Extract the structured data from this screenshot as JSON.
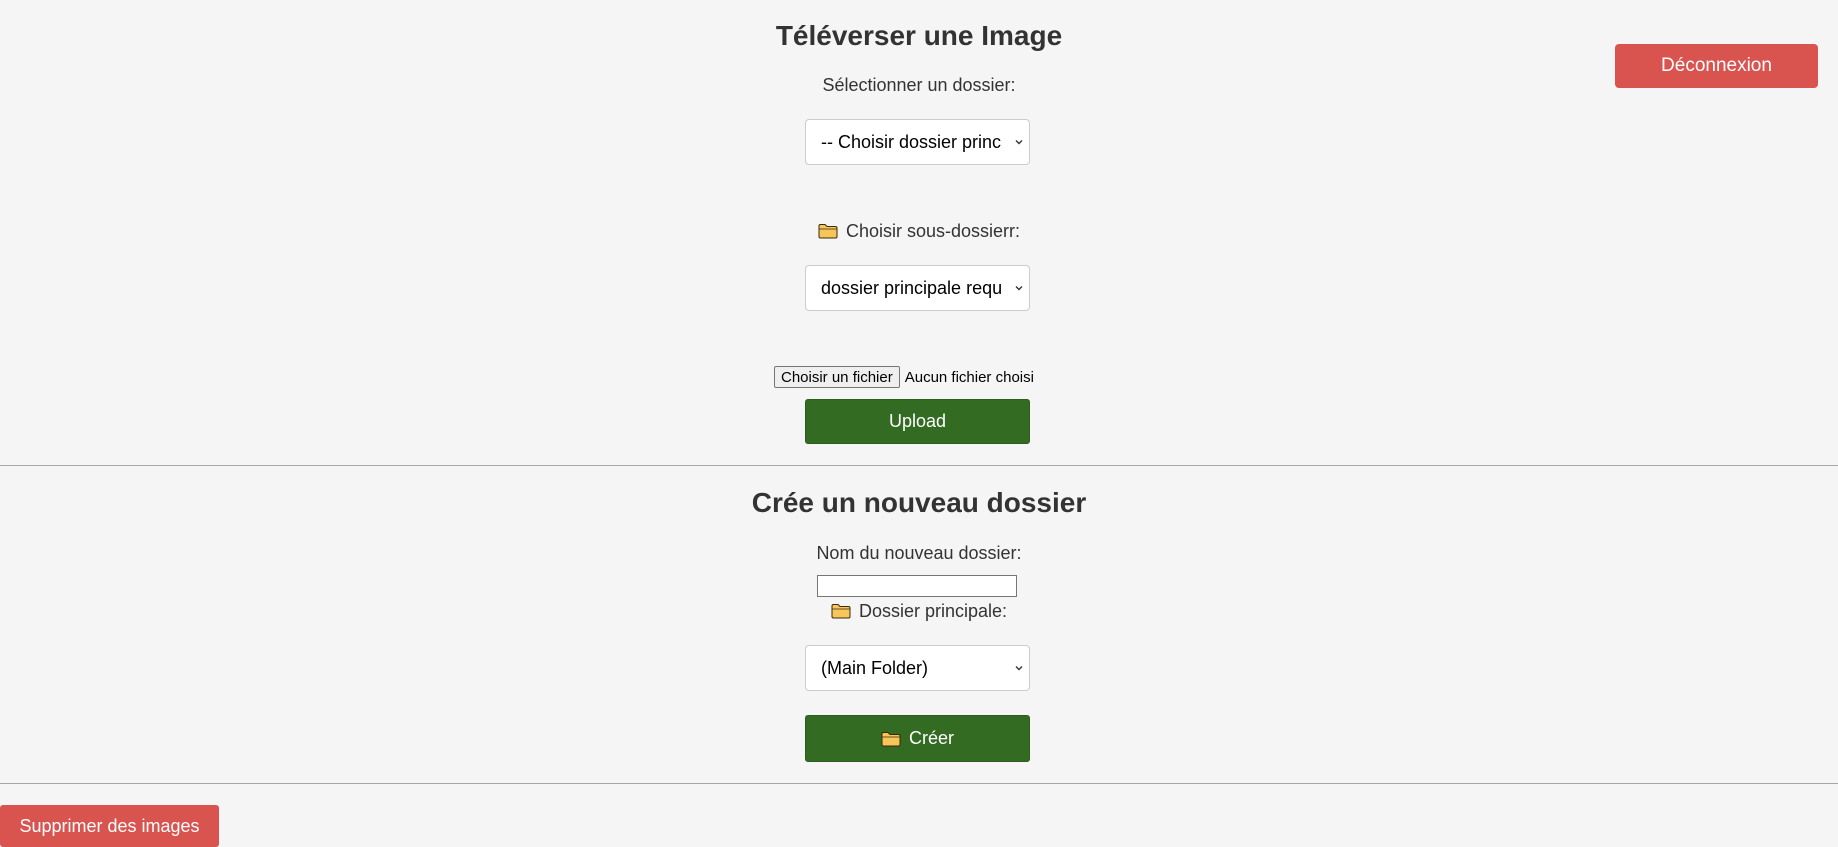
{
  "header": {
    "logout_label": "Déconnexion"
  },
  "upload": {
    "title": "Téléverser une Image",
    "folder_label": "Sélectionner un dossier:",
    "folder_select_value": "-- Choisir dossier princ",
    "subfolder_label": "Choisir sous-dossierr:",
    "subfolder_select_value": "dossier principale requ",
    "file_button_label": "Choisir un fichier",
    "file_status": "Aucun fichier choisi",
    "upload_label": "Upload"
  },
  "create": {
    "title": "Crée un nouveau dossier",
    "name_label": "Nom du nouveau dossier:",
    "name_value": "",
    "parent_label": "Dossier principale:",
    "parent_select_value": "(Main Folder)",
    "create_label": "Créer"
  },
  "footer": {
    "delete_label": "Supprimer des images"
  },
  "icons": {
    "folder": "folder-icon",
    "chevron": "chevron-down-icon"
  },
  "colors": {
    "danger": "#d9534f",
    "primary_green": "#346b22",
    "background": "#f4f5f4",
    "folder_fill": "#f7c65a"
  }
}
